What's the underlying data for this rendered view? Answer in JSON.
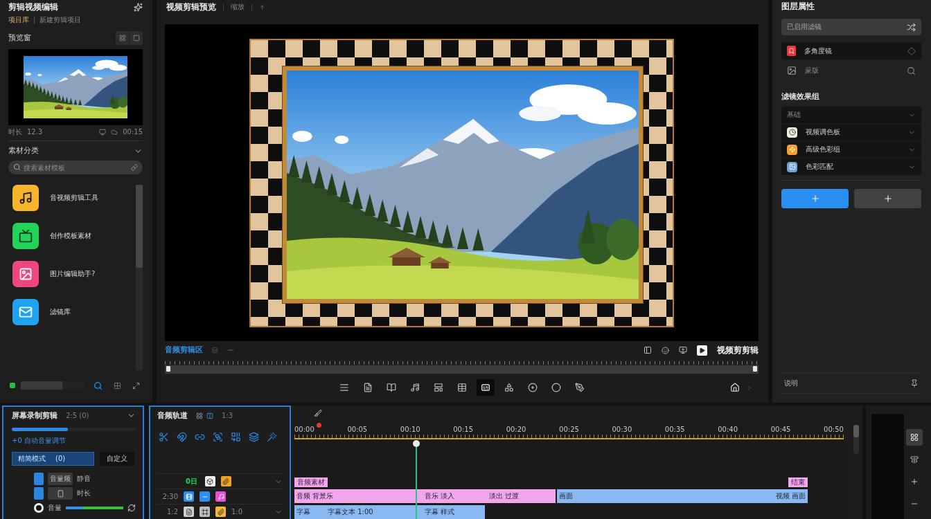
{
  "left_panel": {
    "title": "剪辑视频编辑",
    "breadcrumb": {
      "project": "项目库",
      "separator": "|",
      "path": "新建剪辑项目"
    },
    "preview": {
      "label": "预览窗",
      "duration_label": "时长",
      "duration": "12.3",
      "timecode": "00:15"
    },
    "library": {
      "title": "素材分类",
      "expanded": true,
      "search": {
        "placeholder": "搜索素材模板"
      },
      "items": [
        {
          "label": "音视频剪辑工具",
          "kind": "music",
          "color": "#f7b52c"
        },
        {
          "label": "创作模板素材",
          "kind": "screen",
          "color": "#22d35a"
        },
        {
          "label": "图片编辑助手?",
          "kind": "image",
          "color": "#f0457e"
        },
        {
          "label": "滤镜库",
          "kind": "mail",
          "color": "#1fa3f0"
        }
      ]
    },
    "storage": {
      "level": 0.65
    }
  },
  "preview_panel": {
    "title": "视频剪辑预览",
    "zoom": "缩放",
    "caption": "音频剪辑区",
    "label": "视频剪剪辑",
    "tools": [
      {
        "kind": "list",
        "selected": false
      },
      {
        "kind": "text",
        "selected": false
      },
      {
        "kind": "book",
        "selected": false
      },
      {
        "kind": "music",
        "selected": false
      },
      {
        "kind": "layout",
        "selected": false
      },
      {
        "kind": "table",
        "selected": false
      },
      {
        "kind": "captions",
        "selected": true
      },
      {
        "kind": "shapes",
        "selected": false
      },
      {
        "kind": "disc",
        "selected": false
      },
      {
        "kind": "circle",
        "selected": false
      },
      {
        "kind": "pen",
        "selected": false
      }
    ]
  },
  "right_panel": {
    "title": "图层属性",
    "filter": {
      "value": "已启用滤镜"
    },
    "layers": [
      {
        "label": "多角度镜",
        "kind": "bookmark",
        "selected": true
      },
      {
        "label": "蒙版",
        "kind": "image",
        "selected": false
      }
    ],
    "effects": {
      "title": "滤镜效果组",
      "group": "基础",
      "items": [
        {
          "label": "视频调色板",
          "kind": "clock",
          "color": "#f1ece0"
        },
        {
          "label": "高级色彩组",
          "kind": "sparkle",
          "color": "#f5a02c"
        },
        {
          "label": "色彩匹配",
          "kind": "image",
          "color": "#6fa4d6"
        }
      ]
    },
    "buttons": [
      {
        "primary": true
      },
      {
        "primary": false
      }
    ],
    "footer": "说明"
  },
  "clip_panel": {
    "title": "屏幕录制剪辑",
    "duration": "2:5 (0)",
    "expanded": true,
    "speed": {
      "level": 0.45
    },
    "auto_volume": "+0 自动音量调节",
    "mode": {
      "value": "精简模式",
      "count": "(0)"
    },
    "custom_button": "自定义",
    "rows": [
      {
        "kind": "toggle",
        "on": true,
        "tag": "音量频",
        "label": "静音"
      },
      {
        "kind": "toggle",
        "on": true,
        "label": "时长"
      },
      {
        "kind": "slider",
        "selected": true,
        "label": "音量",
        "level": 0.3
      }
    ]
  },
  "tracks_panel": {
    "title": "音频轨道",
    "counter": "1:3",
    "tracks": [
      {
        "badge": "0日",
        "tiles": [
          {
            "kind": "cube",
            "color": "#f2f2f2"
          },
          {
            "kind": "clip",
            "color": "#f2a31b"
          }
        ],
        "collapsible": true
      },
      {
        "label": "2:30",
        "tiles": [
          {
            "kind": "video",
            "color": "#2c8ef0"
          },
          {
            "kind": "bar",
            "color": "#2c8ef0"
          },
          {
            "kind": "music",
            "color": "#e64fd0"
          }
        ],
        "collapsible": false
      },
      {
        "label": "1:2",
        "tiles": [
          {
            "kind": "doc",
            "color": "#cfcfcf"
          },
          {
            "kind": "frame",
            "color": "#bdbdbd"
          },
          {
            "kind": "clip",
            "color": "#f5b82e"
          }
        ],
        "note": "1:0",
        "collapsible": true
      }
    ]
  },
  "timeline": {
    "ticks": [
      "00:00",
      "00:05",
      "00:10",
      "00:15",
      "00:20",
      "00:25",
      "00:30",
      "00:35",
      "00:40",
      "00:45",
      "00:50"
    ],
    "playhead": {
      "level": 0.222
    },
    "tags": [
      "音频素材",
      "结束"
    ],
    "clip_rows": [
      {
        "clips": [
          {
            "kind": "audio",
            "labels": [
              "音频 背景乐",
              "音乐 淡入",
              "淡出 过渡"
            ]
          },
          {
            "kind": "video",
            "labels": [
              "画面",
              "视频 画面"
            ]
          }
        ]
      },
      {
        "clips": [
          {
            "kind": "subtitle",
            "labels": [
              "字幕",
              "字幕文本 1:00",
              "字幕 样式"
            ]
          }
        ]
      }
    ]
  },
  "side_tools": [
    {
      "kind": "grid",
      "selected": true
    },
    {
      "kind": "align",
      "selected": false
    },
    {
      "kind": "plus",
      "selected": false
    },
    {
      "kind": "minus",
      "selected": false
    }
  ]
}
